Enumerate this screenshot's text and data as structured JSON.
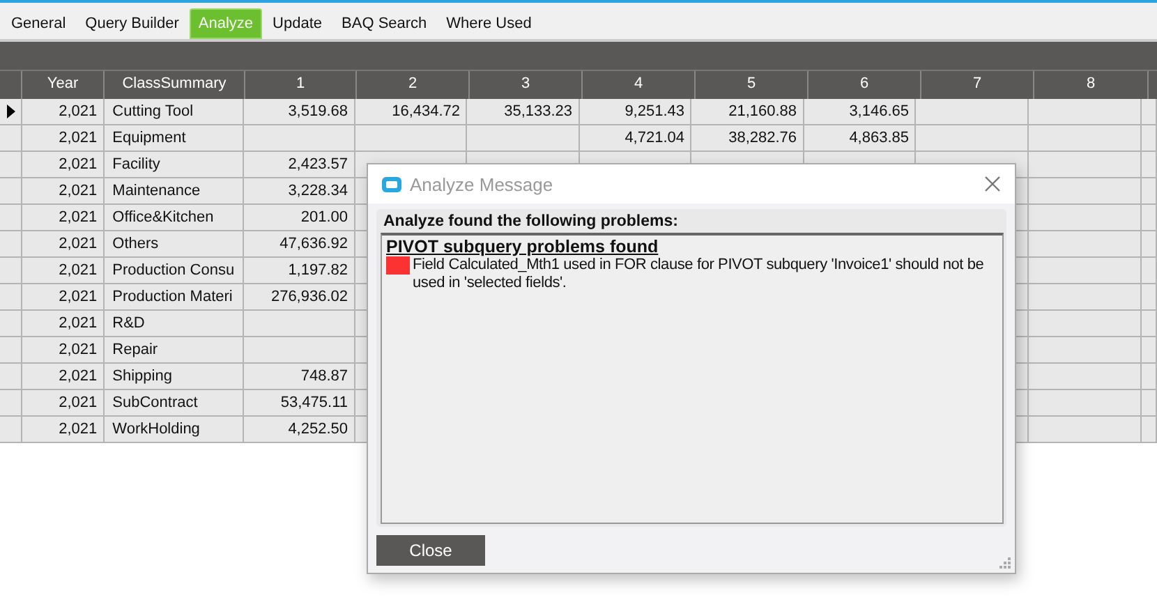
{
  "tabs": [
    {
      "label": "General",
      "selected": false
    },
    {
      "label": "Query Builder",
      "selected": false
    },
    {
      "label": "Analyze",
      "selected": true
    },
    {
      "label": "Update",
      "selected": false
    },
    {
      "label": "BAQ Search",
      "selected": false
    },
    {
      "label": "Where Used",
      "selected": false
    }
  ],
  "table": {
    "columns": [
      "Year",
      "ClassSummary",
      "1",
      "2",
      "3",
      "4",
      "5",
      "6",
      "7",
      "8"
    ],
    "rows": [
      {
        "selected": true,
        "year": "2,021",
        "class": "Cutting Tool",
        "values": {
          "col_1": "3,519.68",
          "col_2": "16,434.72",
          "col_3": "35,133.23",
          "col_4": "9,251.43",
          "col_5": "21,160.88",
          "col_6": "3,146.65"
        }
      },
      {
        "selected": false,
        "year": "2,021",
        "class": "Equipment",
        "values": {
          "col_4": "4,721.04",
          "col_5": "38,282.76",
          "col_6": "4,863.85"
        }
      },
      {
        "selected": false,
        "year": "2,021",
        "class": "Facility",
        "values": {
          "col_1": "2,423.57"
        }
      },
      {
        "selected": false,
        "year": "2,021",
        "class": "Maintenance",
        "values": {
          "col_1": "3,228.34"
        }
      },
      {
        "selected": false,
        "year": "2,021",
        "class": "Office&Kitchen",
        "values": {
          "col_1": "201.00"
        }
      },
      {
        "selected": false,
        "year": "2,021",
        "class": "Others",
        "values": {
          "col_1": "47,636.92"
        }
      },
      {
        "selected": false,
        "year": "2,021",
        "class": "Production Consu",
        "values": {
          "col_1": "1,197.82"
        }
      },
      {
        "selected": false,
        "year": "2,021",
        "class": "Production Materi",
        "values": {
          "col_1": "276,936.02"
        }
      },
      {
        "selected": false,
        "year": "2,021",
        "class": "R&D"
      },
      {
        "selected": false,
        "year": "2,021",
        "class": "Repair"
      },
      {
        "selected": false,
        "year": "2,021",
        "class": "Shipping",
        "values": {
          "col_1": "748.87"
        }
      },
      {
        "selected": false,
        "year": "2,021",
        "class": "SubContract",
        "values": {
          "col_1": "53,475.11"
        }
      },
      {
        "selected": false,
        "year": "2,021",
        "class": "WorkHolding",
        "values": {
          "col_1": "4,252.50"
        }
      }
    ]
  },
  "dialog": {
    "title": "Analyze Message",
    "group_title": "Analyze found the following problems:",
    "heading": "PIVOT subquery problems found",
    "message": "Field Calculated_Mth1 used in FOR clause for PIVOT subquery 'Invoice1'  should not be used in 'selected fields'.",
    "button": "Close"
  }
}
